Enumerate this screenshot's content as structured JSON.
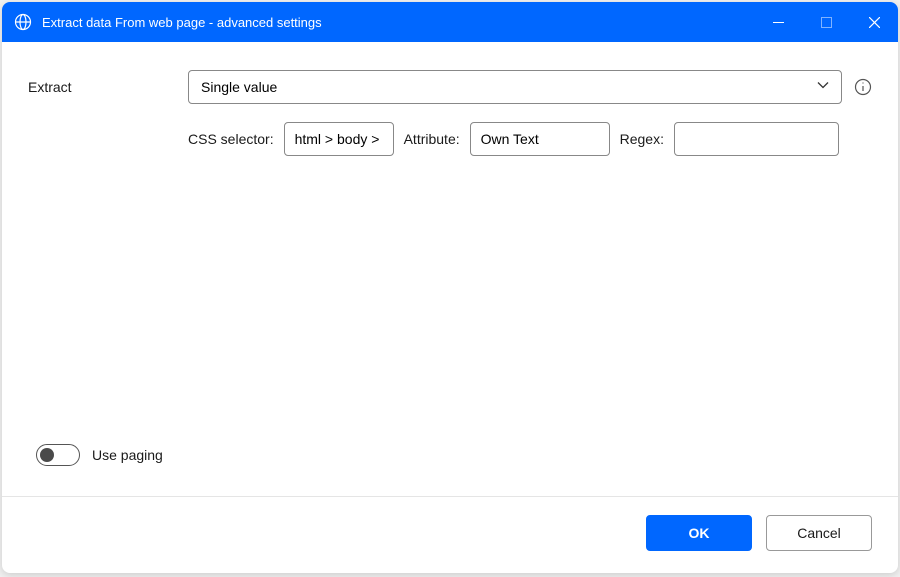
{
  "window": {
    "title": "Extract data From web page - advanced settings"
  },
  "form": {
    "extract_label": "Extract",
    "extract_value": "Single value",
    "css_selector_label": "CSS selector:",
    "css_selector_value": "html > body >",
    "attribute_label": "Attribute:",
    "attribute_value": "Own Text",
    "regex_label": "Regex:",
    "regex_value": ""
  },
  "toggle": {
    "use_paging_label": "Use paging",
    "use_paging_on": false
  },
  "footer": {
    "ok_label": "OK",
    "cancel_label": "Cancel"
  }
}
